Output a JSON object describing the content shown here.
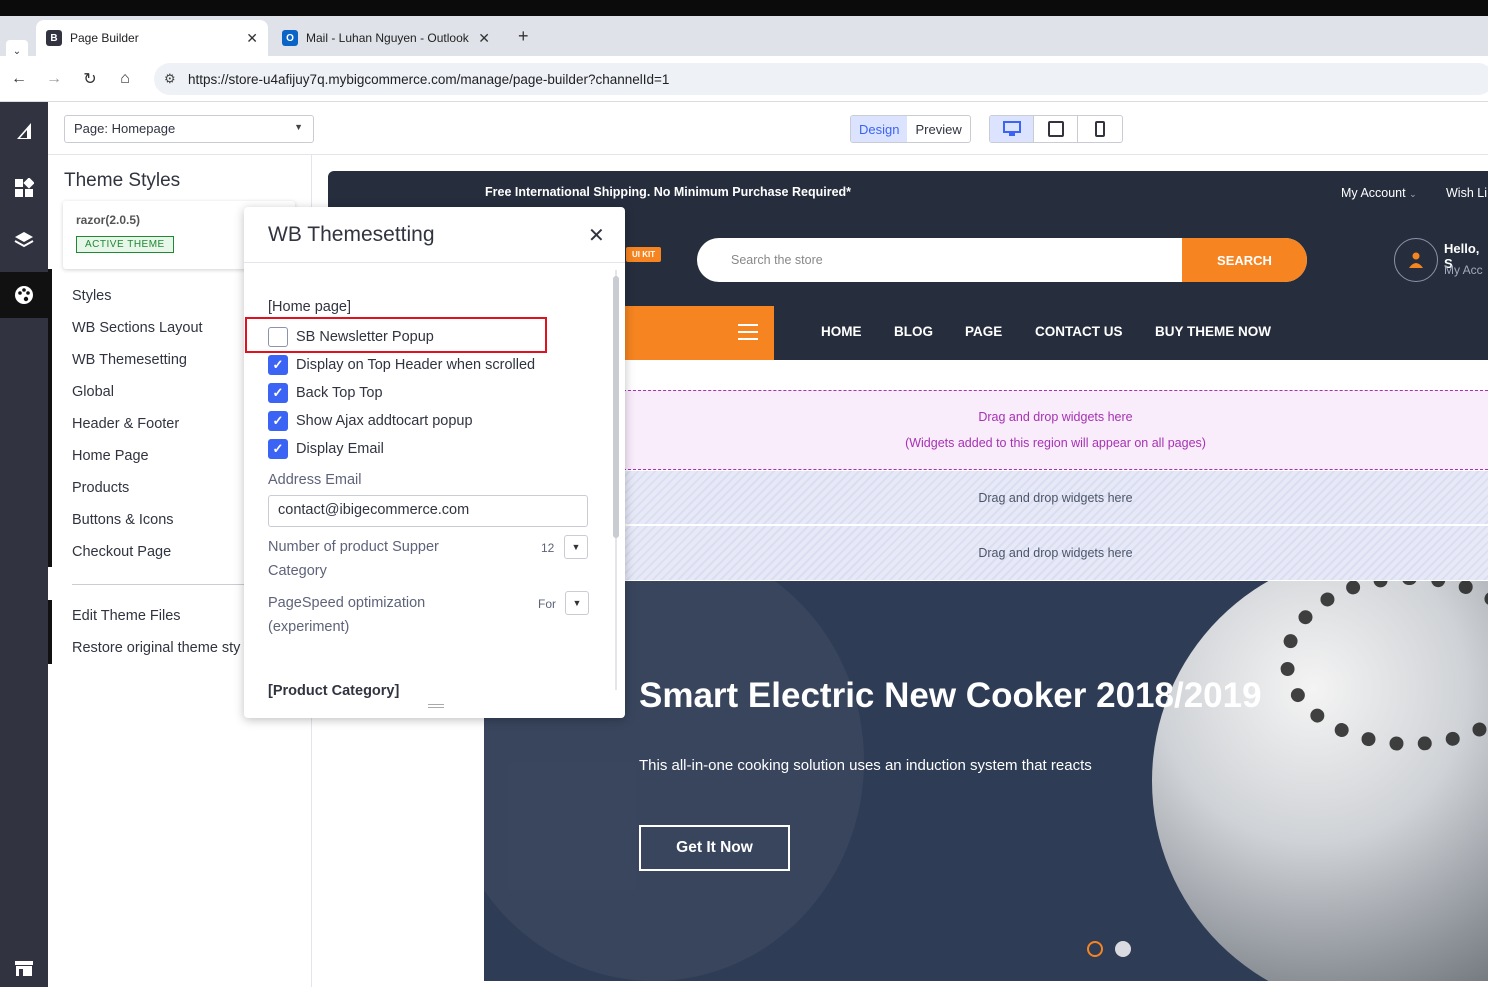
{
  "browser": {
    "tabs": [
      {
        "title": "Page Builder"
      },
      {
        "title": "Mail - Luhan Nguyen - Outlook"
      }
    ],
    "url": "https://store-u4afijuy7q.mybigcommerce.com/manage/page-builder?channelId=1"
  },
  "toolbar": {
    "page_select": "Page: Homepage",
    "mode": {
      "design": "Design",
      "preview": "Preview"
    },
    "devices": [
      "desktop-icon",
      "tablet-icon",
      "mobile-icon"
    ]
  },
  "sidebar": {
    "title": "Theme Styles",
    "theme": {
      "name": "razor(2.0.5)",
      "badge": "ACTIVE THEME"
    },
    "items": [
      {
        "label": "Styles"
      },
      {
        "label": "WB Sections Layout"
      },
      {
        "label": "WB Themesetting"
      },
      {
        "label": "Global"
      },
      {
        "label": "Header & Footer"
      },
      {
        "label": "Home Page"
      },
      {
        "label": "Products"
      },
      {
        "label": "Buttons & Icons"
      },
      {
        "label": "Checkout Page"
      }
    ],
    "footer_items": [
      {
        "label": "Edit Theme Files"
      },
      {
        "label": "Restore original theme sty"
      }
    ]
  },
  "popup": {
    "title": "WB Themesetting",
    "section_home": "[Home page]",
    "checkboxes": [
      {
        "label": "SB Newsletter Popup",
        "checked": false
      },
      {
        "label": "Display on Top Header when scrolled",
        "checked": true
      },
      {
        "label": "Back Top Top",
        "checked": true
      },
      {
        "label": "Show Ajax addtocart popup",
        "checked": true
      },
      {
        "label": "Display Email",
        "checked": true
      }
    ],
    "address_email_label": "Address Email",
    "address_email_value": "contact@ibigecommerce.com",
    "supper_category_label": "Number of product Supper Category",
    "supper_category_value": "12",
    "pagespeed_label": "PageSpeed optimization (experiment)",
    "pagespeed_value": "For",
    "section_product_category": "[Product Category]"
  },
  "store": {
    "topbar": {
      "promo": "Free International Shipping. No Minimum Purchase Required*",
      "account": "My Account",
      "wish": "Wish Li"
    },
    "uikit": "UI KIT",
    "search_placeholder": "Search the store",
    "search_button": "SEARCH",
    "user_hello": "Hello, S",
    "user_account": "My Acc",
    "nav": [
      "HOME",
      "BLOG",
      "PAGE",
      "CONTACT US",
      "BUY THEME NOW"
    ],
    "dropzone_global": {
      "line1": "Drag and drop widgets here",
      "line2": "(Widgets added to this region will appear on all pages)"
    },
    "dropzone_1": "Drag and drop widgets here",
    "dropzone_2": "Drag and drop widgets here",
    "hero": {
      "title": "Smart Electric New Cooker 2018/2019",
      "subtitle": "This all-in-one cooking solution uses an induction system that reacts",
      "button": "Get It Now"
    }
  },
  "colors": {
    "accent_orange": "#f68420",
    "bc_blue": "#3c64f4",
    "highlight_red": "#e0121f",
    "dark_navy": "#262e3e"
  }
}
